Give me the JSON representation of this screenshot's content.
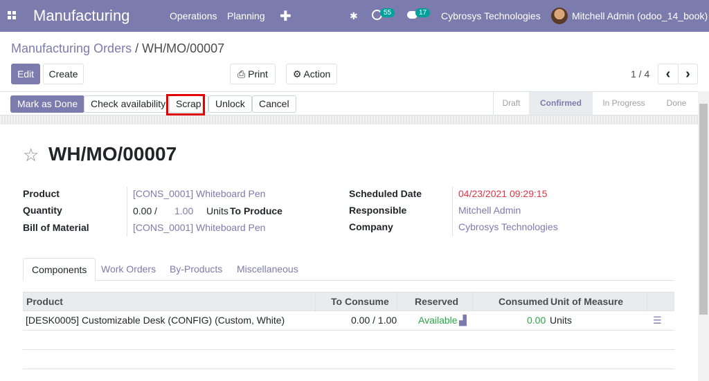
{
  "navbar": {
    "app_name": "Manufacturing",
    "menus": [
      "Operations",
      "Planning"
    ],
    "plus": "✚",
    "activity_count": "55",
    "message_count": "17",
    "company": "Cybrosys Technologies",
    "user": "Mitchell Admin (odoo_14_book)"
  },
  "breadcrumb": {
    "parent": "Manufacturing Orders",
    "separator": " / ",
    "current": "WH/MO/00007"
  },
  "control": {
    "edit": "Edit",
    "create": "Create",
    "print": "Print",
    "action": "Action",
    "pager": "1 / 4",
    "prev": "‹",
    "next": "›"
  },
  "status_buttons": [
    "Mark as Done",
    "Check availability",
    "Scrap",
    "Unlock",
    "Cancel"
  ],
  "stages": [
    "Draft",
    "Confirmed",
    "In Progress",
    "Done"
  ],
  "record": {
    "title": "WH/MO/00007",
    "fields_left": [
      {
        "label": "Product",
        "value": "[CONS_0001] Whiteboard Pen"
      },
      {
        "label": "Quantity",
        "value": ""
      },
      {
        "label": "Bill of Material",
        "value": "[CONS_0001] Whiteboard Pen"
      }
    ],
    "quantity": {
      "produced": "0.00",
      "slash": "/",
      "target": "1.00",
      "unit": "Units",
      "suffix": "To Produce"
    },
    "fields_right": [
      {
        "label": "Scheduled Date",
        "value": "04/23/2021 09:29:15"
      },
      {
        "label": "Responsible",
        "value": "Mitchell Admin"
      },
      {
        "label": "Company",
        "value": "Cybrosys Technologies"
      }
    ]
  },
  "tabs": [
    "Components",
    "Work Orders",
    "By-Products",
    "Miscellaneous"
  ],
  "table": {
    "headers": [
      "Product",
      "To Consume",
      "Reserved",
      "Consumed",
      "Unit of Measure"
    ],
    "rows": [
      {
        "product": "[DESK0005] Customizable Desk (CONFIG) (Custom, White)",
        "to_consume": "0.00 / 1.00",
        "reserved": "Available",
        "consumed": "0.00",
        "uom": "Units"
      }
    ]
  },
  "colors": {
    "brand": "#7c7bad",
    "danger": "#dc3545",
    "success": "#28a745",
    "highlight": "#e00000"
  }
}
